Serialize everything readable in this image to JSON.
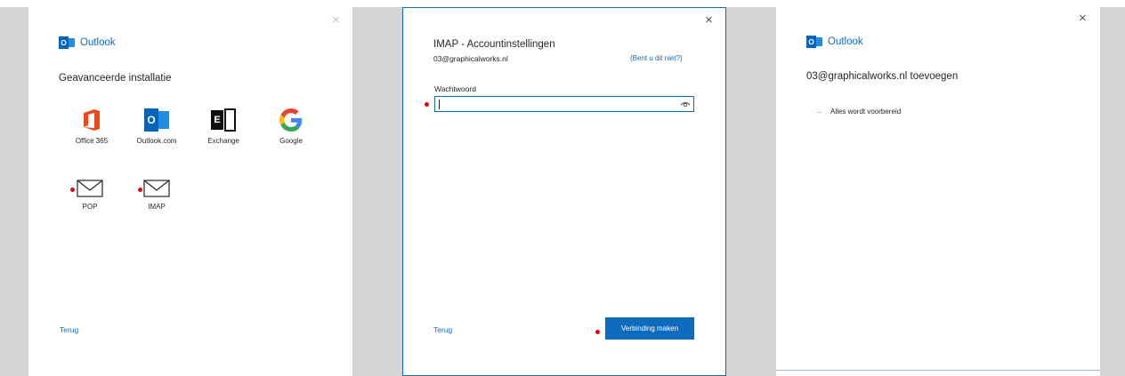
{
  "panel1": {
    "brand": "Outlook",
    "logo_letter": "O",
    "heading": "Geavanceerde installatie",
    "providers": [
      {
        "label": "Office 365",
        "icon": "office365-icon"
      },
      {
        "label": "Outlook.com",
        "icon": "outlook-icon"
      },
      {
        "label": "Exchange",
        "icon": "exchange-icon"
      },
      {
        "label": "Google",
        "icon": "google-icon"
      }
    ],
    "mail_options": [
      {
        "label": "POP",
        "icon": "envelope-icon"
      },
      {
        "label": "IMAP",
        "icon": "envelope-icon"
      }
    ],
    "back": "Terug",
    "close": "×"
  },
  "panel2": {
    "title": "IMAP - Accountinstellingen",
    "email": "03@graphicalworks.nl",
    "not_you": "(Bent u dit niet?)",
    "password_label": "Wachtwoord",
    "password_value": "",
    "back": "Terug",
    "connect": "Verbinding maken",
    "close": "×"
  },
  "panel3": {
    "brand": "Outlook",
    "logo_letter": "O",
    "heading": "03@graphicalworks.nl toevoegen",
    "status": "Alles wordt voorbereid",
    "close": "×"
  },
  "colors": {
    "accent": "#0f6cbd",
    "marker": "#e3000f",
    "backdrop": "#d4d4d4"
  }
}
